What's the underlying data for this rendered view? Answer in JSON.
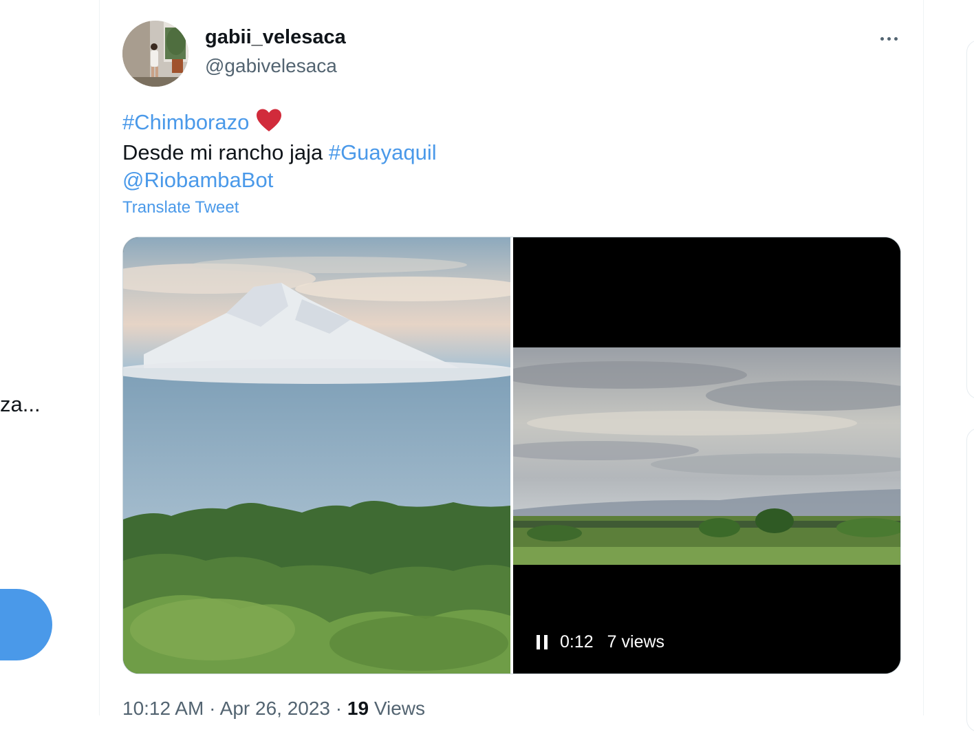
{
  "left_column": {
    "snippet_text": "za..."
  },
  "tweet": {
    "author": {
      "display_name": "gabii_velesaca",
      "handle": "@gabivelesaca"
    },
    "text": {
      "hashtag_1": "#Chimborazo",
      "line_2_text": "Desde mi rancho jaja ",
      "hashtag_2": "#Guayaquil",
      "mention": "@RiobambaBot"
    },
    "translate_label": "Translate Tweet",
    "media": {
      "video_time": "0:12",
      "video_views": "7 views"
    },
    "meta": {
      "time": "10:12 AM",
      "date": "Apr 26, 2023",
      "views_count": "19",
      "views_label": "Views",
      "separator": "·"
    }
  },
  "icons": {
    "more": "more-icon",
    "heart": "heart-icon",
    "pause": "pause-icon"
  },
  "colors": {
    "link": "#4a99e9",
    "text": "#0f1419",
    "secondary": "#536471",
    "heart": "#d12b3b"
  }
}
